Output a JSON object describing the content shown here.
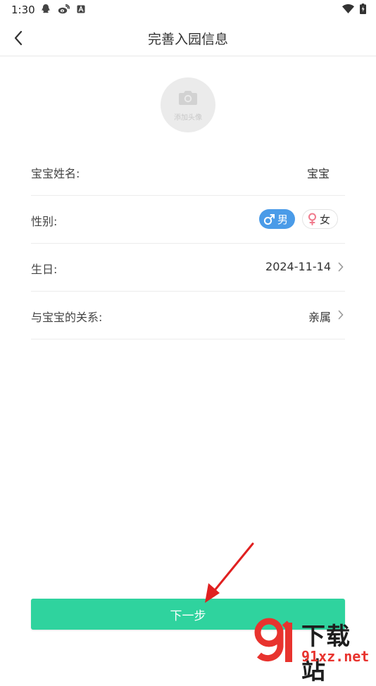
{
  "status": {
    "time": "1:30"
  },
  "header": {
    "title": "完善入园信息"
  },
  "avatar": {
    "label": "添加头像"
  },
  "form": {
    "name": {
      "label": "宝宝姓名:",
      "value": "宝宝"
    },
    "gender": {
      "label": "性别:",
      "male": "男",
      "female": "女",
      "selected": "男"
    },
    "birthday": {
      "label": "生日:",
      "value": "2024-11-14"
    },
    "relation": {
      "label": "与宝宝的关系:",
      "value": "亲属"
    }
  },
  "next_button": {
    "label": "下一步"
  },
  "watermark": {
    "top": "下载站",
    "bottom": "91xz.net"
  },
  "colors": {
    "accent": "#2fd39e",
    "male": "#4a9be8",
    "female": "#f07a8c",
    "annotation": "#e02020"
  }
}
